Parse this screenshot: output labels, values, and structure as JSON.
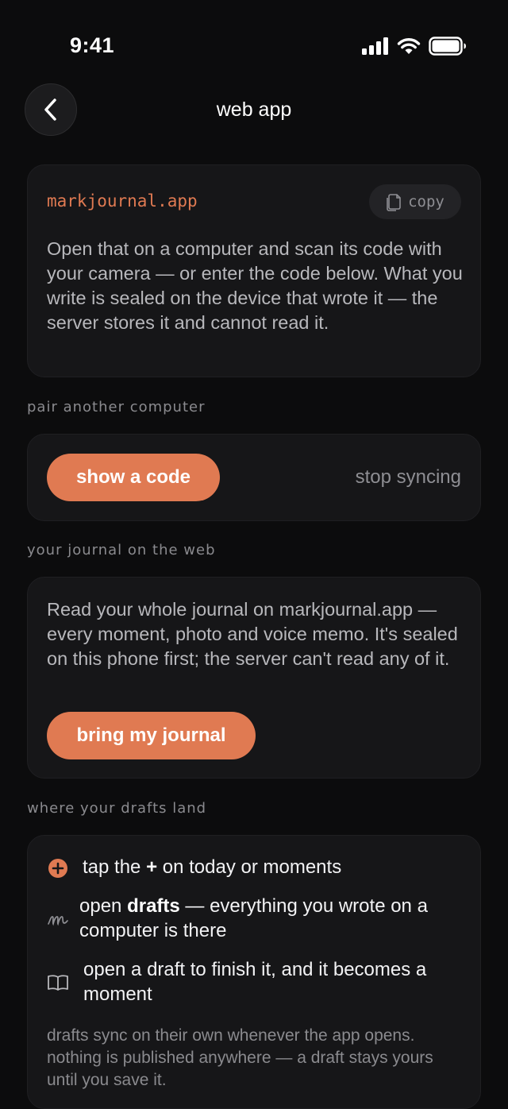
{
  "status": {
    "time": "9:41"
  },
  "nav": {
    "title": "web app",
    "back_icon": "chevron-left-icon"
  },
  "web_card": {
    "url": "markjournal.app",
    "copy_label": "copy",
    "description": "Open that on a computer and scan its code with your camera — or enter the code below. What you write is sealed on the device that wrote it — the server stores it and cannot read it."
  },
  "pair_section": {
    "label": "pair another computer",
    "show_code_label": "show a code",
    "stop_syncing_label": "stop syncing"
  },
  "journal_section": {
    "label": "your journal on the web",
    "description": "Read your whole journal on markjournal.app — every moment, photo and voice memo. It's sealed on this phone first; the server can't read any of it.",
    "button_label": "bring my journal"
  },
  "drafts_section": {
    "label": "where your drafts land",
    "steps": [
      {
        "icon": "plus-circle-icon",
        "pre": "tap the ",
        "bold": "+",
        "post": " on today or moments"
      },
      {
        "icon": "script-m-icon",
        "pre": "open ",
        "bold": "drafts",
        "post": " — everything you wrote on a computer is there"
      },
      {
        "icon": "open-book-icon",
        "pre": "open a draft to finish it, and it becomes a moment",
        "bold": "",
        "post": ""
      }
    ],
    "footnote": "drafts sync on their own whenever the app opens. nothing is published anywhere — a draft stays yours until you save it."
  },
  "colors": {
    "accent": "#e07a52",
    "background": "#0c0c0d",
    "card": "#161618"
  }
}
